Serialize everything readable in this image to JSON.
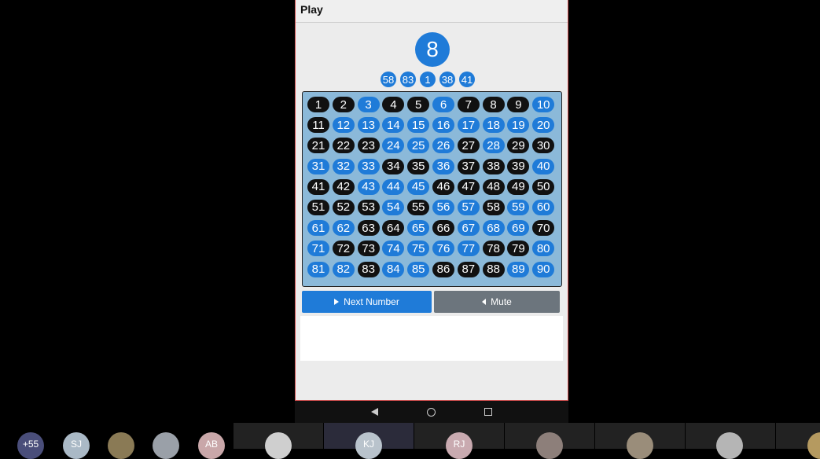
{
  "app": {
    "title": "Play"
  },
  "current_number": "8",
  "recent_numbers": [
    "58",
    "83",
    "1",
    "38",
    "41"
  ],
  "board": {
    "numbers": [
      "1",
      "2",
      "3",
      "4",
      "5",
      "6",
      "7",
      "8",
      "9",
      "10",
      "11",
      "12",
      "13",
      "14",
      "15",
      "16",
      "17",
      "18",
      "19",
      "20",
      "21",
      "22",
      "23",
      "24",
      "25",
      "26",
      "27",
      "28",
      "29",
      "30",
      "31",
      "32",
      "33",
      "34",
      "35",
      "36",
      "37",
      "38",
      "39",
      "40",
      "41",
      "42",
      "43",
      "44",
      "45",
      "46",
      "47",
      "48",
      "49",
      "50",
      "51",
      "52",
      "53",
      "54",
      "55",
      "56",
      "57",
      "58",
      "59",
      "60",
      "61",
      "62",
      "63",
      "64",
      "65",
      "66",
      "67",
      "68",
      "69",
      "70",
      "71",
      "72",
      "73",
      "74",
      "75",
      "76",
      "77",
      "78",
      "79",
      "80",
      "81",
      "82",
      "83",
      "84",
      "85",
      "86",
      "87",
      "88",
      "89",
      "90"
    ],
    "called": [
      "1",
      "2",
      "4",
      "5",
      "7",
      "8",
      "9",
      "11",
      "21",
      "22",
      "23",
      "27",
      "29",
      "30",
      "34",
      "35",
      "37",
      "38",
      "39",
      "41",
      "42",
      "46",
      "47",
      "48",
      "49",
      "50",
      "51",
      "52",
      "53",
      "55",
      "58",
      "63",
      "64",
      "66",
      "70",
      "72",
      "73",
      "78",
      "79",
      "83",
      "86",
      "87",
      "88"
    ]
  },
  "buttons": {
    "next_label": "Next Number",
    "mute_label": "Mute"
  },
  "colors": {
    "called": "#111111",
    "uncalled": "#1f7bd8",
    "board_bg": "#8bb9d9",
    "next_button": "#1f7bd8",
    "mute_button": "#6c757d"
  },
  "icons": {
    "next": "play-triangle-icon",
    "mute": "speaker-icon"
  },
  "participants": [
    "+55",
    "SJ",
    "",
    "",
    "AB",
    "",
    "KJ",
    "RJ",
    "",
    "",
    "",
    ""
  ]
}
